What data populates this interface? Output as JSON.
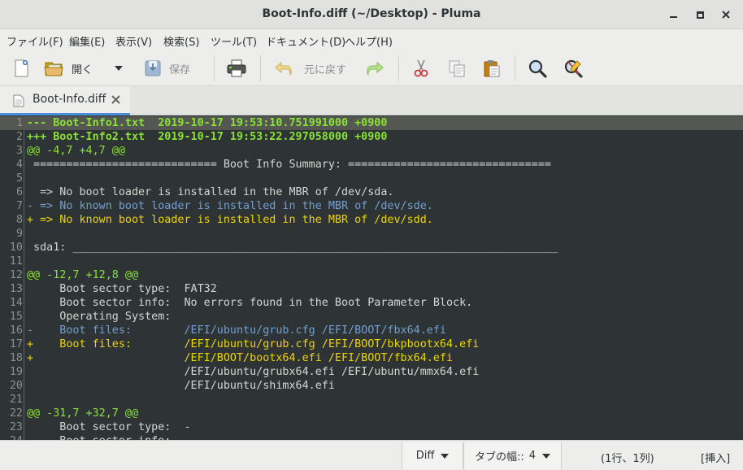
{
  "window": {
    "title": "Boot-Info.diff (~/Desktop) - Pluma",
    "minimize_glyph": "—",
    "maximize_glyph": "☐",
    "close_glyph": "✕"
  },
  "menu": [
    "ファイル(F)",
    "編集(E)",
    "表示(V)",
    "検索(S)",
    "ツール(T)",
    "ドキュメント(D)",
    "ヘルプ(H)"
  ],
  "toolbar": {
    "open_label": "開く",
    "save_label": "保存",
    "undo_label": "元に戻す"
  },
  "tab": {
    "label": "Boot-Info.diff",
    "close_glyph": "✖"
  },
  "editor": {
    "current_line": 1,
    "lines": [
      {
        "n": "1",
        "t": "--- Boot-Info1.txt  2019-10-17 19:53:10.751991000 +0900",
        "k": "hdr"
      },
      {
        "n": "2",
        "t": "+++ Boot-Info2.txt  2019-10-17 19:53:22.297058000 +0900",
        "k": "hdr"
      },
      {
        "n": "3",
        "t": "@@ -4,7 +4,7 @@",
        "k": "hunk"
      },
      {
        "n": "4",
        "t": " ============================ Boot Info Summary: ===============================",
        "k": "plain"
      },
      {
        "n": "5",
        "t": "",
        "k": "plain"
      },
      {
        "n": "6",
        "t": "  => No boot loader is installed in the MBR of /dev/sda.",
        "k": "plain"
      },
      {
        "n": "7",
        "t": "- => No known boot loader is installed in the MBR of /dev/sde.",
        "k": "del"
      },
      {
        "n": "8",
        "t": "+ => No known boot loader is installed in the MBR of /dev/sdd.",
        "k": "add"
      },
      {
        "n": "9",
        "t": "",
        "k": "plain"
      },
      {
        "n": "10",
        "t": " sda1: __________________________________________________________________________",
        "k": "plain"
      },
      {
        "n": "11",
        "t": "",
        "k": "plain"
      },
      {
        "n": "12",
        "t": "@@ -12,7 +12,8 @@",
        "k": "hunk"
      },
      {
        "n": "13",
        "t": "     Boot sector type:  FAT32",
        "k": "plain"
      },
      {
        "n": "14",
        "t": "     Boot sector info:  No errors found in the Boot Parameter Block.",
        "k": "plain"
      },
      {
        "n": "15",
        "t": "     Operating System:",
        "k": "plain"
      },
      {
        "n": "16",
        "t": "-    Boot files:        /EFI/ubuntu/grub.cfg /EFI/BOOT/fbx64.efi",
        "k": "del"
      },
      {
        "n": "17",
        "t": "+    Boot files:        /EFI/ubuntu/grub.cfg /EFI/BOOT/bkpbootx64.efi",
        "k": "add"
      },
      {
        "n": "18",
        "t": "+                       /EFI/BOOT/bootx64.efi /EFI/BOOT/fbx64.efi",
        "k": "add"
      },
      {
        "n": "19",
        "t": "                        /EFI/ubuntu/grubx64.efi /EFI/ubuntu/mmx64.efi",
        "k": "plain"
      },
      {
        "n": "20",
        "t": "                        /EFI/ubuntu/shimx64.efi",
        "k": "plain"
      },
      {
        "n": "21",
        "t": "",
        "k": "plain"
      },
      {
        "n": "22",
        "t": "@@ -31,7 +32,7 @@",
        "k": "hunk"
      },
      {
        "n": "23",
        "t": "     Boot sector type:  -",
        "k": "plain"
      },
      {
        "n": "24",
        "t": "     Boot sector info:",
        "k": "plain"
      }
    ]
  },
  "status": {
    "language": "Diff",
    "tab_width_label": "タブの幅::",
    "tab_width_value": "4",
    "position": "(1行、1列)",
    "mode": "[挿入]"
  },
  "icons": {
    "new": "new-document-icon",
    "open": "folder-open-icon",
    "save": "save-icon",
    "print": "print-icon",
    "undo": "undo-icon",
    "redo": "redo-icon",
    "cut": "cut-icon",
    "copy": "copy-icon",
    "paste": "paste-icon",
    "find": "search-icon",
    "replace": "find-replace-icon"
  },
  "colors": {
    "editor_bg": "#2e3436",
    "header": "#8ae234",
    "added": "#edd400",
    "removed": "#729fcf",
    "plain": "#d3d7cf",
    "tab_accent": "#4a90d9"
  }
}
